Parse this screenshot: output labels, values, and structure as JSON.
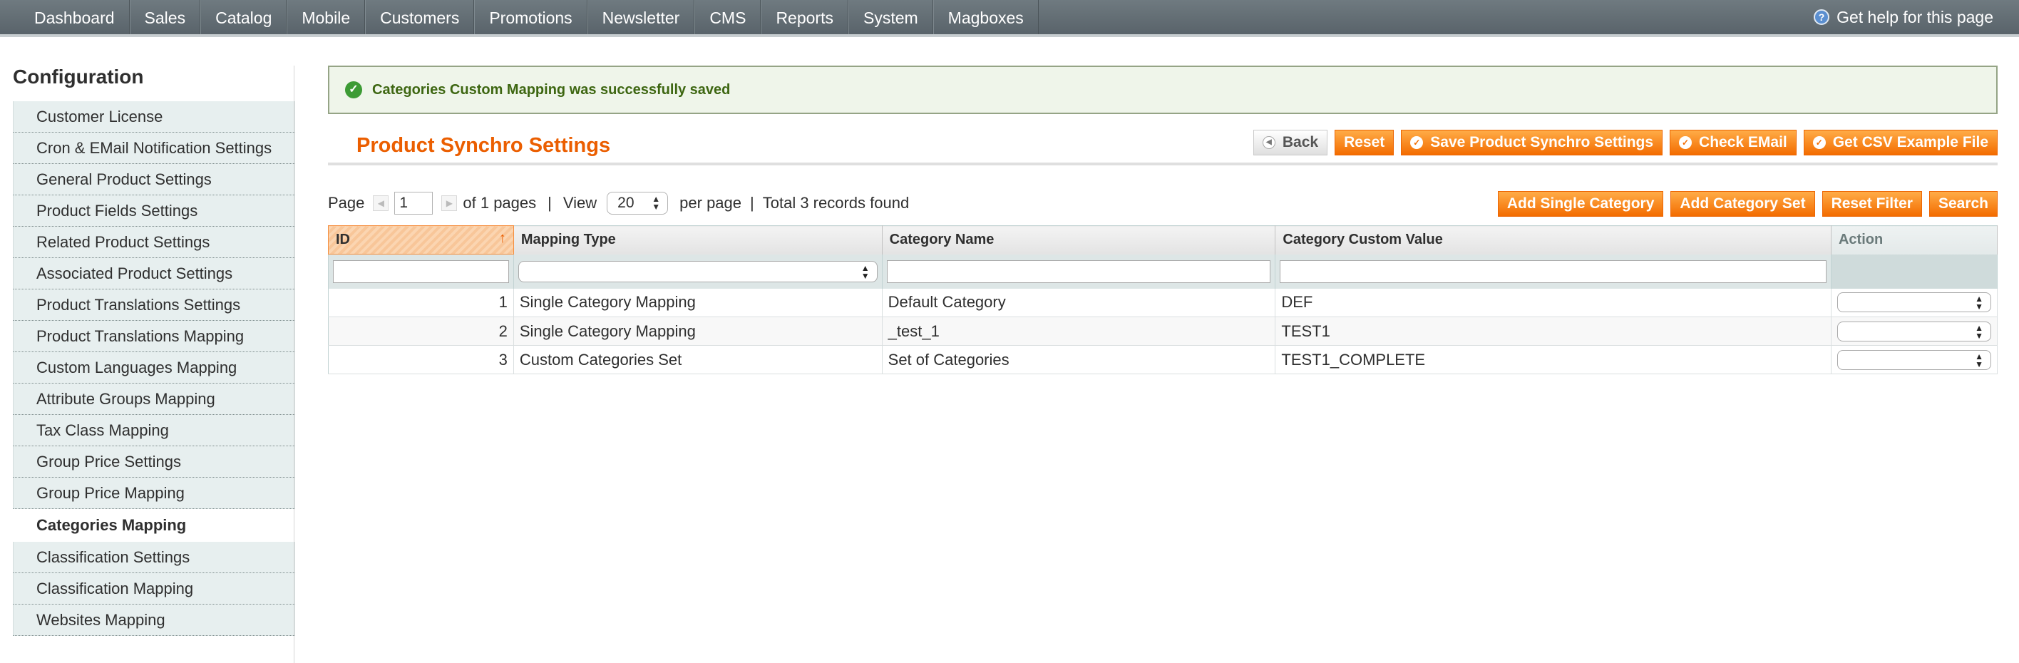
{
  "nav": {
    "items": [
      "Dashboard",
      "Sales",
      "Catalog",
      "Mobile",
      "Customers",
      "Promotions",
      "Newsletter",
      "CMS",
      "Reports",
      "System",
      "Magboxes"
    ],
    "help": "Get help for this page"
  },
  "sidebar": {
    "title": "Configuration",
    "items": [
      {
        "label": "Customer License",
        "active": false
      },
      {
        "label": "Cron & EMail Notification Settings",
        "active": false
      },
      {
        "label": "General Product Settings",
        "active": false
      },
      {
        "label": "Product Fields Settings",
        "active": false
      },
      {
        "label": "Related Product Settings",
        "active": false
      },
      {
        "label": "Associated Product Settings",
        "active": false
      },
      {
        "label": "Product Translations Settings",
        "active": false
      },
      {
        "label": "Product Translations Mapping",
        "active": false
      },
      {
        "label": "Custom Languages Mapping",
        "active": false
      },
      {
        "label": "Attribute Groups Mapping",
        "active": false
      },
      {
        "label": "Tax Class Mapping",
        "active": false
      },
      {
        "label": "Group Price Settings",
        "active": false
      },
      {
        "label": "Group Price Mapping",
        "active": false
      },
      {
        "label": "Categories Mapping",
        "active": true
      },
      {
        "label": "Classification Settings",
        "active": false
      },
      {
        "label": "Classification Mapping",
        "active": false
      },
      {
        "label": "Websites Mapping",
        "active": false
      }
    ]
  },
  "message": "Categories Custom Mapping was successfully saved",
  "header": {
    "title": "Product Synchro Settings",
    "back": "Back",
    "reset": "Reset",
    "save": "Save Product Synchro Settings",
    "check_email": "Check EMail",
    "csv": "Get CSV Example File"
  },
  "pager": {
    "page_label": "Page",
    "page_value": "1",
    "of_pages": "of 1 pages",
    "sep1": "|",
    "view_label": "View",
    "view_value": "20",
    "per_page": "per page",
    "sep2": "|",
    "total": "Total 3 records found"
  },
  "grid_buttons": {
    "add_single": "Add Single Category",
    "add_set": "Add Category Set",
    "reset_filter": "Reset Filter",
    "search": "Search"
  },
  "grid": {
    "columns": [
      "ID",
      "Mapping Type",
      "Category Name",
      "Category Custom Value",
      "Action"
    ],
    "rows": [
      {
        "id": "1",
        "type": "Single Category Mapping",
        "name": "Default Category",
        "value": "DEF"
      },
      {
        "id": "2",
        "type": "Single Category Mapping",
        "name": "_test_1",
        "value": "TEST1"
      },
      {
        "id": "3",
        "type": "Custom Categories Set",
        "name": "Set of Categories",
        "value": "TEST1_COMPLETE"
      }
    ]
  },
  "colors": {
    "accent": "#eb5e00",
    "button": "#f36c00",
    "nav_bg": "#616b72",
    "success": "#3d6611"
  },
  "icons": {
    "help": "help-circle-icon",
    "success": "check-circle-icon",
    "back": "back-arrow-icon",
    "button_check": "check-circle-icon",
    "sort": "sort-up-arrow-icon"
  }
}
